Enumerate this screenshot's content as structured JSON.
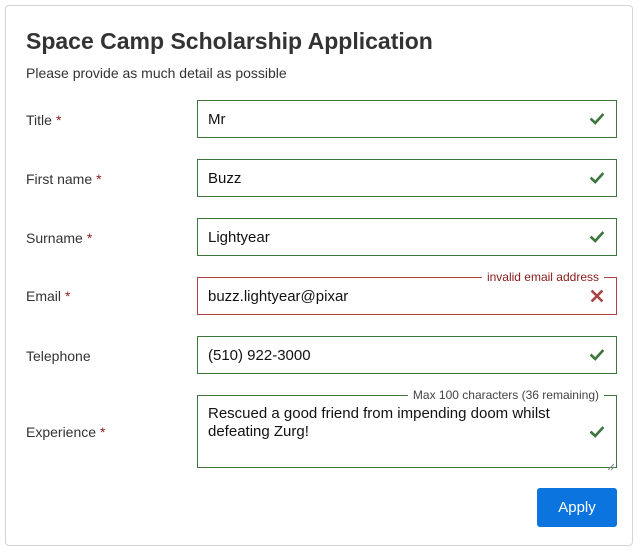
{
  "form": {
    "title": "Space Camp Scholarship Application",
    "subtitle": "Please provide as much detail as possible",
    "required_marker": "*",
    "fields": {
      "title": {
        "label": "Title",
        "required": true,
        "value": "Mr",
        "status": "valid",
        "status_icon": "check-icon"
      },
      "first_name": {
        "label": "First name",
        "required": true,
        "value": "Buzz",
        "status": "valid",
        "status_icon": "check-icon"
      },
      "surname": {
        "label": "Surname",
        "required": true,
        "value": "Lightyear",
        "status": "valid",
        "status_icon": "check-icon"
      },
      "email": {
        "label": "Email",
        "required": true,
        "value": "buzz.lightyear@pixar",
        "status": "invalid",
        "status_icon": "cross-icon",
        "message": "invalid email address"
      },
      "telephone": {
        "label": "Telephone",
        "required": false,
        "value": "(510) 922-3000",
        "status": "valid",
        "status_icon": "check-icon"
      },
      "experience": {
        "label": "Experience",
        "required": true,
        "value": "Rescued a good friend from impending doom whilst defeating Zurg!",
        "status": "valid",
        "status_icon": "check-icon",
        "hint": "Max 100 characters (36 remaining)"
      }
    },
    "submit_label": "Apply"
  },
  "colors": {
    "valid": "#3c763d",
    "invalid": "#a94442",
    "required_marker": "#8b1a1a",
    "button": "#0b74de",
    "border": "#d4d4d4"
  }
}
